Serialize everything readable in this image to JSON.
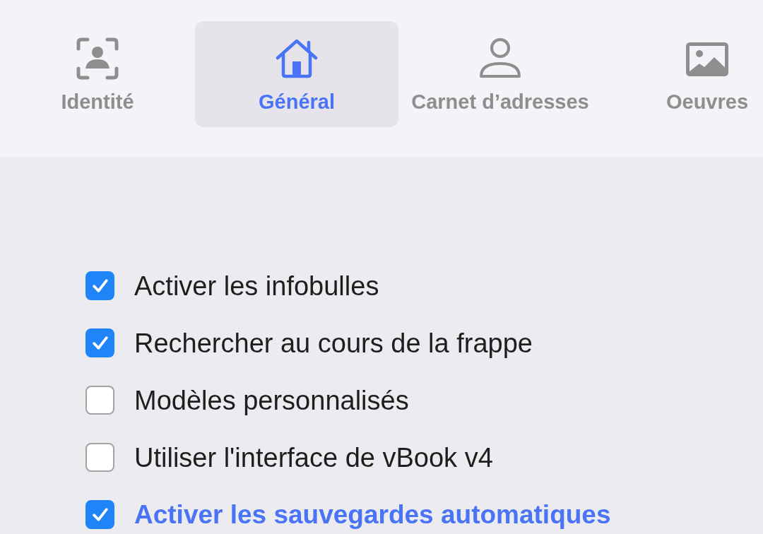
{
  "toolbar": {
    "tabs": [
      {
        "label": "Identité",
        "selected": false
      },
      {
        "label": "Général",
        "selected": true
      },
      {
        "label": "Carnet d’adresses",
        "selected": false
      },
      {
        "label": "Oeuvres",
        "selected": false
      }
    ]
  },
  "options": [
    {
      "label": "Activer les infobulles",
      "checked": true,
      "highlighted": false
    },
    {
      "label": "Rechercher au cours de la frappe",
      "checked": true,
      "highlighted": false
    },
    {
      "label": "Modèles personnalisés",
      "checked": false,
      "highlighted": false
    },
    {
      "label": "Utiliser l'interface de vBook v4",
      "checked": false,
      "highlighted": false
    },
    {
      "label": "Activer les sauvegardes automatiques",
      "checked": true,
      "highlighted": true
    }
  ]
}
